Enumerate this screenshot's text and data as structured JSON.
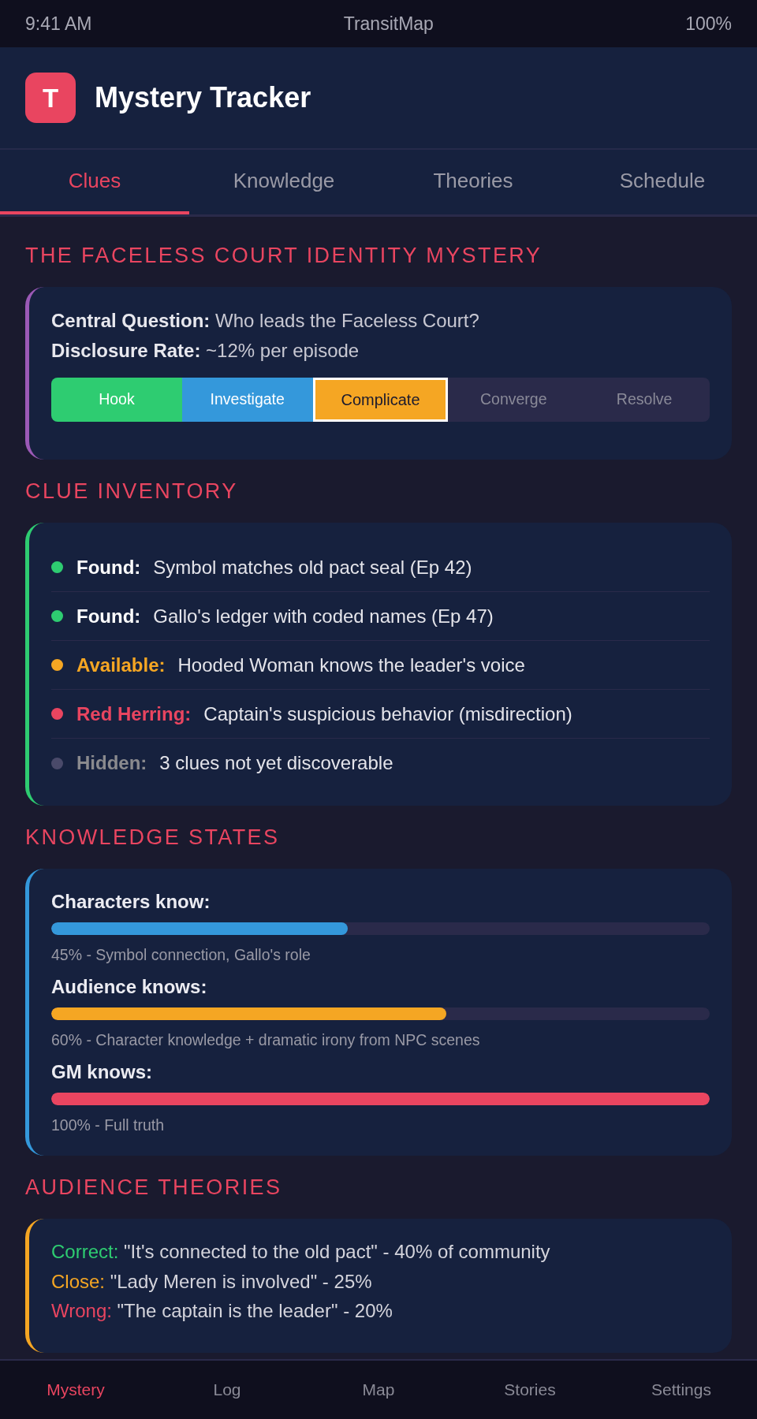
{
  "status_bar": {
    "time": "9:41 AM",
    "app": "TransitMap",
    "battery": "100%"
  },
  "header": {
    "logo": "T",
    "title": "Mystery Tracker"
  },
  "tabs": [
    {
      "label": "Clues",
      "selected": true
    },
    {
      "label": "Knowledge",
      "selected": false
    },
    {
      "label": "Theories",
      "selected": false
    },
    {
      "label": "Schedule",
      "selected": false
    }
  ],
  "mystery": {
    "title": "THE FACELESS COURT IDENTITY MYSTERY",
    "facts": [
      "**Central Question:** Who leads the Faceless Court?",
      "**Disclosure Rate:** ~12% per episode"
    ],
    "phases": [
      {
        "label": "Hook",
        "completed": true,
        "current": false,
        "color": "#2ecc71"
      },
      {
        "label": "Investigate",
        "completed": true,
        "current": false,
        "color": "#3498db"
      },
      {
        "label": "Complicate",
        "completed": false,
        "current": true,
        "color": "#f5a623"
      },
      {
        "label": "Converge",
        "completed": false,
        "current": false
      },
      {
        "label": "Resolve",
        "completed": false,
        "current": false
      }
    ]
  },
  "clue_inventory": {
    "title": "CLUE INVENTORY",
    "clues": [
      {
        "kind": "found",
        "label": "Found:",
        "text": "Symbol matches old pact seal (Ep 42)",
        "color": "#2ecc71"
      },
      {
        "kind": "found",
        "label": "Found:",
        "text": "Gallo's ledger with coded names (Ep 47)",
        "color": "#2ecc71"
      },
      {
        "kind": "available",
        "label": "Available:",
        "text": "Hooded Woman knows the leader's voice",
        "color": "#f5a623"
      },
      {
        "kind": "red_herring",
        "label": "Red Herring:",
        "text": "Captain's suspicious behavior (misdirection)",
        "color": "#e94560"
      },
      {
        "kind": "hidden",
        "label": "Hidden:",
        "text": "3 clues not yet discoverable",
        "color": "#4a4a6a"
      }
    ]
  },
  "knowledge_states": {
    "title": "KNOWLEDGE STATES",
    "items": [
      {
        "label": "Characters know:",
        "level": 0.45,
        "color": "#3498db",
        "caption": "45% - Symbol connection, Gallo's role"
      },
      {
        "label": "Audience knows:",
        "level": 0.6,
        "color": "#f5a623",
        "caption": "60% - Character knowledge + dramatic irony from NPC scenes"
      },
      {
        "label": "GM knows:",
        "level": 1,
        "color": "#e94560",
        "caption": "100% - Full truth"
      }
    ]
  },
  "audience_theories": {
    "title": "AUDIENCE THEORIES",
    "theories": [
      {
        "verdict": "Correct:",
        "text": "\"It's connected to the old pact\" - 40% of community",
        "color": "#2ecc71"
      },
      {
        "verdict": "Close:",
        "text": "\"Lady Meren is involved\" - 25%",
        "color": "#f5a623"
      },
      {
        "verdict": "Wrong:",
        "text": "\"The captain is the leader\" - 20%",
        "color": "#e94560"
      }
    ]
  },
  "bottom_nav": [
    {
      "label": "Mystery",
      "selected": true
    },
    {
      "label": "Log",
      "selected": false
    },
    {
      "label": "Map",
      "selected": false
    },
    {
      "label": "Stories",
      "selected": false
    },
    {
      "label": "Settings",
      "selected": false
    }
  ]
}
